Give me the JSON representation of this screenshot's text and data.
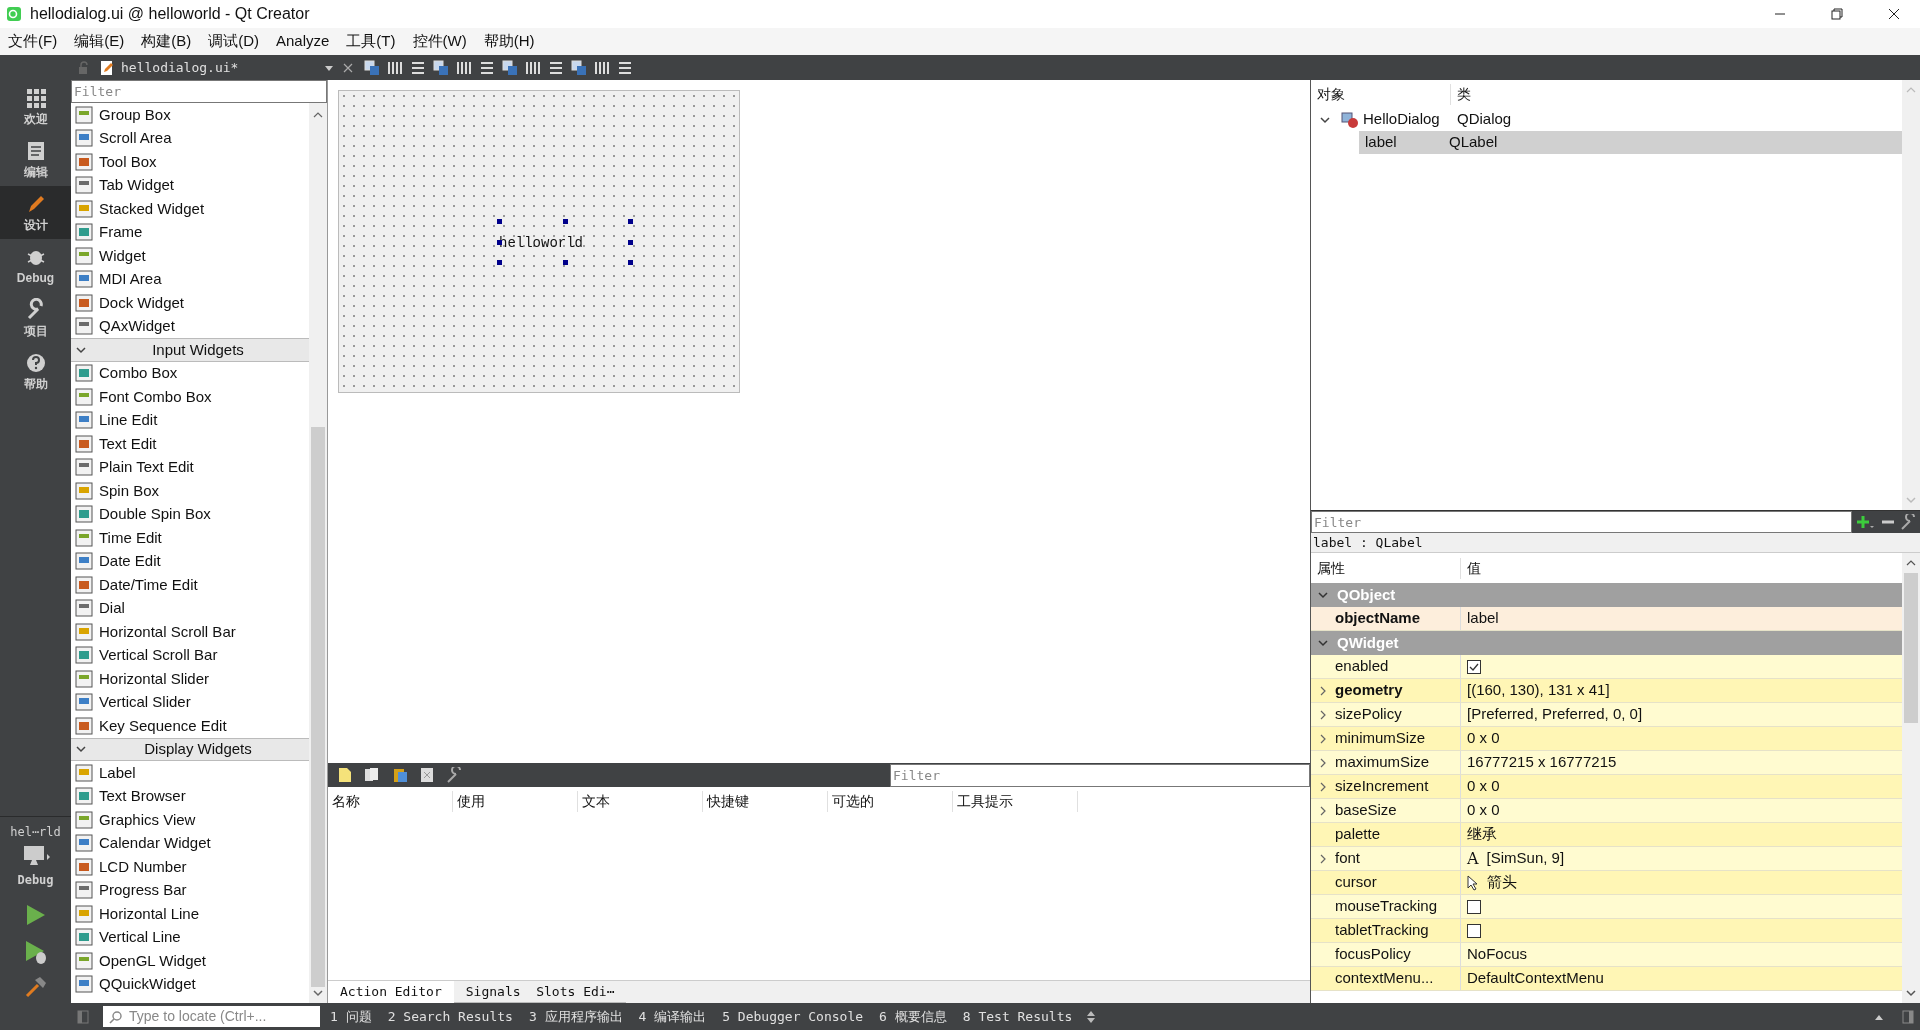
{
  "window": {
    "title": "hellodialog.ui @ helloworld - Qt Creator"
  },
  "menu": [
    "文件(F)",
    "编辑(E)",
    "构建(B)",
    "调试(D)",
    "Analyze",
    "工具(T)",
    "控件(W)",
    "帮助(H)"
  ],
  "modes": [
    {
      "label": "欢迎",
      "selected": false
    },
    {
      "label": "编辑",
      "selected": false
    },
    {
      "label": "设计",
      "selected": true
    },
    {
      "label": "Debug",
      "selected": false
    },
    {
      "label": "项目",
      "selected": false
    },
    {
      "label": "帮助",
      "selected": false
    }
  ],
  "kit": {
    "project": "hel⋯rld",
    "build": "Debug"
  },
  "editor_toolbar": {
    "file": "hellodialog.ui*"
  },
  "widget_box": {
    "filter_placeholder": "Filter",
    "items": [
      {
        "kind": "item",
        "label": "Group Box"
      },
      {
        "kind": "item",
        "label": "Scroll Area"
      },
      {
        "kind": "item",
        "label": "Tool Box"
      },
      {
        "kind": "item",
        "label": "Tab Widget"
      },
      {
        "kind": "item",
        "label": "Stacked Widget"
      },
      {
        "kind": "item",
        "label": "Frame"
      },
      {
        "kind": "item",
        "label": "Widget"
      },
      {
        "kind": "item",
        "label": "MDI Area"
      },
      {
        "kind": "item",
        "label": "Dock Widget"
      },
      {
        "kind": "item",
        "label": "QAxWidget"
      },
      {
        "kind": "category",
        "label": "Input Widgets",
        "expanded": true
      },
      {
        "kind": "item",
        "label": "Combo Box"
      },
      {
        "kind": "item",
        "label": "Font Combo Box"
      },
      {
        "kind": "item",
        "label": "Line Edit"
      },
      {
        "kind": "item",
        "label": "Text Edit"
      },
      {
        "kind": "item",
        "label": "Plain Text Edit"
      },
      {
        "kind": "item",
        "label": "Spin Box"
      },
      {
        "kind": "item",
        "label": "Double Spin Box"
      },
      {
        "kind": "item",
        "label": "Time Edit"
      },
      {
        "kind": "item",
        "label": "Date Edit"
      },
      {
        "kind": "item",
        "label": "Date/Time Edit"
      },
      {
        "kind": "item",
        "label": "Dial"
      },
      {
        "kind": "item",
        "label": "Horizontal Scroll Bar"
      },
      {
        "kind": "item",
        "label": "Vertical Scroll Bar"
      },
      {
        "kind": "item",
        "label": "Horizontal Slider"
      },
      {
        "kind": "item",
        "label": "Vertical Slider"
      },
      {
        "kind": "item",
        "label": "Key Sequence Edit"
      },
      {
        "kind": "category",
        "label": "Display Widgets",
        "expanded": true
      },
      {
        "kind": "item",
        "label": "Label"
      },
      {
        "kind": "item",
        "label": "Text Browser"
      },
      {
        "kind": "item",
        "label": "Graphics View"
      },
      {
        "kind": "item",
        "label": "Calendar Widget"
      },
      {
        "kind": "item",
        "label": "LCD Number"
      },
      {
        "kind": "item",
        "label": "Progress Bar"
      },
      {
        "kind": "item",
        "label": "Horizontal Line"
      },
      {
        "kind": "item",
        "label": "Vertical Line"
      },
      {
        "kind": "item",
        "label": "OpenGL Widget"
      },
      {
        "kind": "item",
        "label": "QQuickWidget"
      }
    ]
  },
  "form": {
    "label_text": "helloworld"
  },
  "action_editor": {
    "filter_placeholder": "Filter",
    "columns": [
      "名称",
      "使用",
      "文本",
      "快捷键",
      "可选的",
      "工具提示"
    ],
    "tabs": [
      {
        "label": "Action Editor",
        "selected": true
      },
      {
        "label": "Signals  Slots Edi⋯",
        "selected": false
      }
    ]
  },
  "object_inspector": {
    "columns": [
      "对象",
      "类"
    ],
    "tree": [
      {
        "name": "HelloDialog",
        "class": "QDialog",
        "expanded": true,
        "selected": false,
        "children": [
          {
            "name": "label",
            "class": "QLabel",
            "selected": true
          }
        ]
      }
    ]
  },
  "property_editor": {
    "filter_placeholder": "Filter",
    "object": "label : QLabel",
    "columns": [
      "属性",
      "值"
    ],
    "groups": [
      {
        "name": "QObject",
        "expanded": true,
        "color": "#fdeedc",
        "properties": [
          {
            "name": "objectName",
            "kind": "text",
            "value": "label",
            "modified": true,
            "expandable": false
          }
        ]
      },
      {
        "name": "QWidget",
        "expanded": true,
        "color": "#fffbd0",
        "properties": [
          {
            "name": "enabled",
            "kind": "checkbox",
            "checked": true,
            "modified": false,
            "expandable": false
          },
          {
            "name": "geometry",
            "kind": "text",
            "value": "[(160, 130), 131 x 41]",
            "modified": true,
            "expandable": true
          },
          {
            "name": "sizePolicy",
            "kind": "text",
            "value": "[Preferred, Preferred, 0, 0]",
            "modified": false,
            "expandable": true
          },
          {
            "name": "minimumSize",
            "kind": "text",
            "value": "0 x 0",
            "modified": false,
            "expandable": true
          },
          {
            "name": "maximumSize",
            "kind": "text",
            "value": "16777215 x 16777215",
            "modified": false,
            "expandable": true
          },
          {
            "name": "sizeIncrement",
            "kind": "text",
            "value": "0 x 0",
            "modified": false,
            "expandable": true
          },
          {
            "name": "baseSize",
            "kind": "text",
            "value": "0 x 0",
            "modified": false,
            "expandable": true
          },
          {
            "name": "palette",
            "kind": "text",
            "value": "继承",
            "modified": false,
            "expandable": false
          },
          {
            "name": "font",
            "kind": "font",
            "glyph": "A",
            "value": "[SimSun, 9]",
            "modified": false,
            "expandable": true
          },
          {
            "name": "cursor",
            "kind": "cursor",
            "value": "箭头",
            "modified": false,
            "expandable": false
          },
          {
            "name": "mouseTracking",
            "kind": "checkbox",
            "checked": false,
            "modified": false,
            "expandable": false
          },
          {
            "name": "tabletTracking",
            "kind": "checkbox",
            "checked": false,
            "modified": false,
            "expandable": false
          },
          {
            "name": "focusPolicy",
            "kind": "text",
            "value": "NoFocus",
            "modified": false,
            "expandable": false
          },
          {
            "name": "contextMenu...",
            "kind": "text",
            "value": "DefaultContextMenu",
            "modified": false,
            "expandable": false
          }
        ]
      }
    ]
  },
  "status_bar": {
    "locator_placeholder": "Type to locate (Ctrl+...",
    "panes": [
      "1 问题",
      "2 Search Results",
      "3 应用程序输出",
      "4 编译输出",
      "5 Debugger Console",
      "6 概要信息",
      "8 Test Results"
    ]
  }
}
